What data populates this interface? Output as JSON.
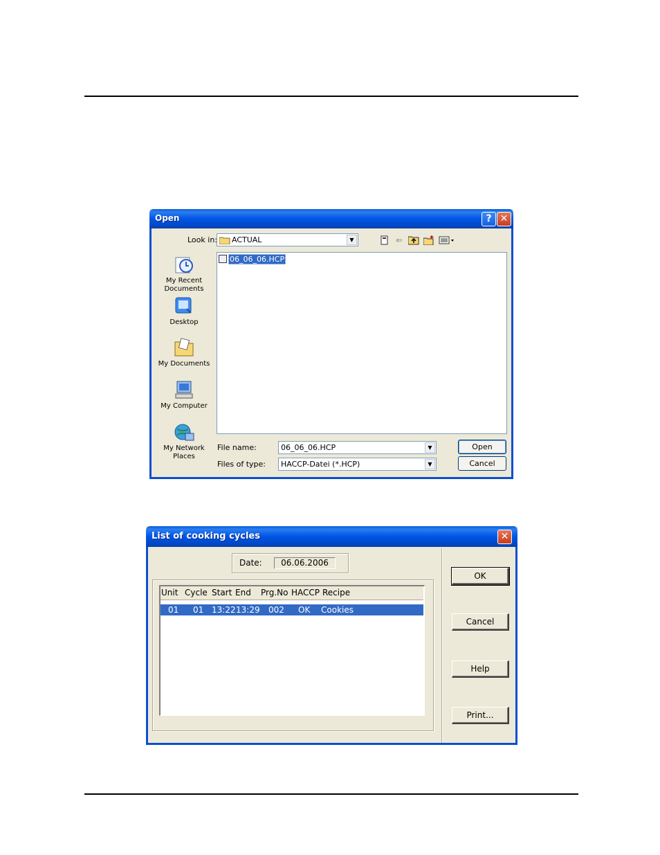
{
  "open_dialog": {
    "title": "Open",
    "help_button": "?",
    "close_button": "✕",
    "look_in_label": "Look in:",
    "look_in_value": "ACTUAL",
    "places": [
      {
        "label_line1": "My Recent",
        "label_line2": "Documents",
        "icon": "recent-documents-icon"
      },
      {
        "label_line1": "Desktop",
        "label_line2": "",
        "icon": "desktop-icon"
      },
      {
        "label_line1": "My Documents",
        "label_line2": "",
        "icon": "my-documents-icon"
      },
      {
        "label_line1": "My Computer",
        "label_line2": "",
        "icon": "my-computer-icon"
      },
      {
        "label_line1": "My Network",
        "label_line2": "Places",
        "icon": "network-places-icon"
      }
    ],
    "files": [
      "06_06_06.HCP"
    ],
    "file_name_label": "File name:",
    "file_name_value": "06_06_06.HCP",
    "files_of_type_label": "Files of type:",
    "files_of_type_value": "HACCP-Datei (*.HCP)",
    "open_button": "Open",
    "cancel_button": "Cancel"
  },
  "cycles_dialog": {
    "title": "List of cooking cycles",
    "close_button": "✕",
    "date_label": "Date:",
    "date_value": "06.06.2006",
    "columns": [
      "Unit",
      "Cycle",
      "Start",
      "End",
      "Prg.No",
      "HACCP",
      "Recipe"
    ],
    "rows": [
      [
        "01",
        "01",
        "13:22",
        "13:29",
        "002",
        "OK",
        "Cookies"
      ]
    ],
    "ok_button": "OK",
    "cancel_button": "Cancel",
    "help_button": "Help",
    "print_button": "Print..."
  },
  "colors": {
    "titlebar_blue": "#0055e5",
    "selection_blue": "#316ac5",
    "dialog_face": "#ece9d8"
  }
}
